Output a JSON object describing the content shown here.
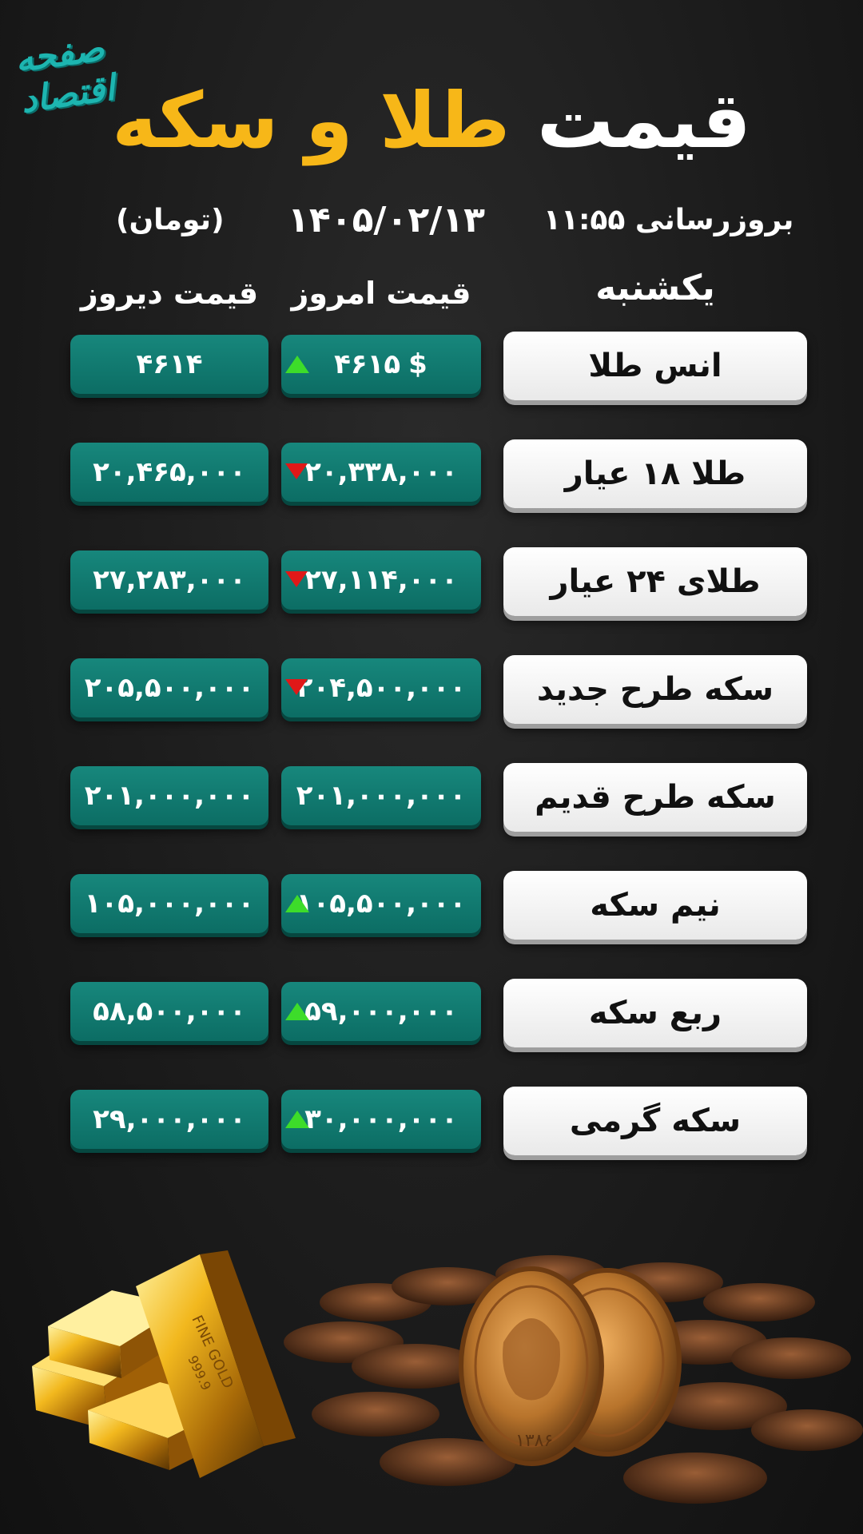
{
  "logo": {
    "text": "صفحه اقتصاد"
  },
  "title": {
    "part_white": "قیمت",
    "part_gold": "طلا و سکه"
  },
  "meta": {
    "update": "بروزرسانی ۱۱:۵۵",
    "date": "۱۴۰۵/۰۲/۱۳",
    "unit": "(تومان)"
  },
  "columns": {
    "day": "یکشنبه",
    "today": "قیمت امروز",
    "yesterday": "قیمت دیروز"
  },
  "rows": [
    {
      "name": "انس طلا",
      "today": "۴۶۱۵",
      "currency": "$",
      "yesterday": "۴۶۱۴",
      "trend": "up"
    },
    {
      "name": "طلا ۱۸ عیار",
      "today": "۲۰,۳۳۸,۰۰۰",
      "yesterday": "۲۰,۴۶۵,۰۰۰",
      "trend": "down"
    },
    {
      "name": "طلای ۲۴ عیار",
      "today": "۲۷,۱۱۴,۰۰۰",
      "yesterday": "۲۷,۲۸۳,۰۰۰",
      "trend": "down"
    },
    {
      "name": "سکه طرح جدید",
      "today": "۲۰۴,۵۰۰,۰۰۰",
      "yesterday": "۲۰۵,۵۰۰,۰۰۰",
      "trend": "down"
    },
    {
      "name": "سکه طرح قدیم",
      "today": "۲۰۱,۰۰۰,۰۰۰",
      "yesterday": "۲۰۱,۰۰۰,۰۰۰",
      "trend": "none"
    },
    {
      "name": "نیم سکه",
      "today": "۱۰۵,۵۰۰,۰۰۰",
      "yesterday": "۱۰۵,۰۰۰,۰۰۰",
      "trend": "up"
    },
    {
      "name": "ربع سکه",
      "today": "۵۹,۰۰۰,۰۰۰",
      "yesterday": "۵۸,۵۰۰,۰۰۰",
      "trend": "up"
    },
    {
      "name": "سکه گرمی",
      "today": "۳۰,۰۰۰,۰۰۰",
      "yesterday": "۲۹,۰۰۰,۰۰۰",
      "trend": "up"
    }
  ],
  "illustration": {
    "coin_year": "۱۳۸۶",
    "bar_label": "FINE GOLD",
    "bar_purity": "999.9"
  },
  "colors": {
    "gold": "#f7b718",
    "teal": "#0f7b71",
    "up": "#3ddc2a",
    "down": "#e01818",
    "logo": "#1db5b0"
  }
}
